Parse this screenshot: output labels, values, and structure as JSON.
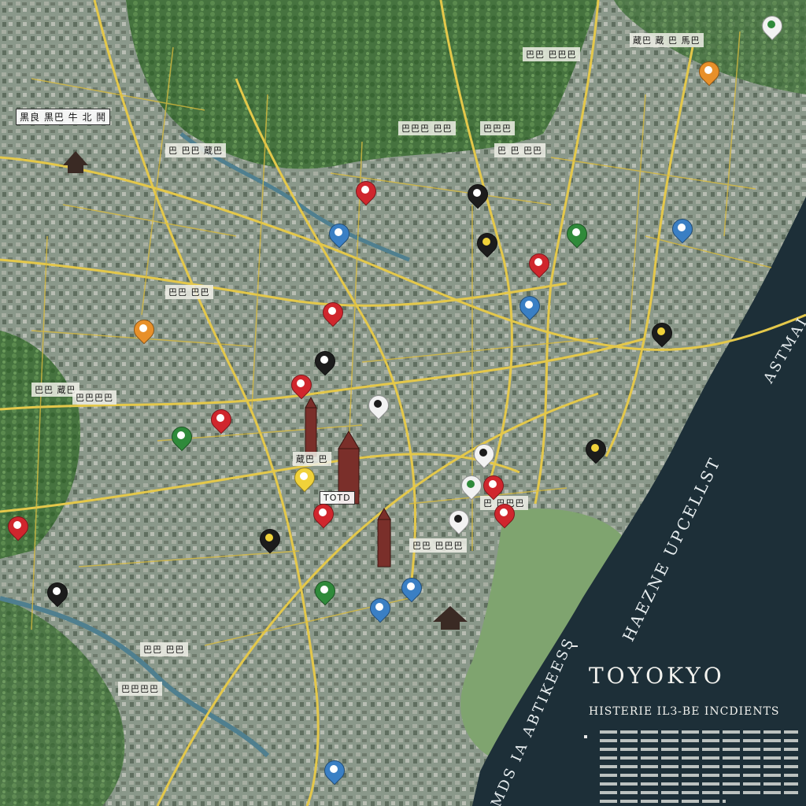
{
  "map": {
    "title": "TOYOKYO",
    "subtitle": "HISTERIE ILЗ-BE INCDIENTS",
    "sea_labels": {
      "upper": "ASTMAI",
      "middle_1": "HAEZNE UPCELLST",
      "middle_2": "MDS IA ABTIKEESS"
    },
    "place_labels": [
      "黒良 黒巴 牛 北 鬨",
      "蔵巴 蔵 巴 馬巴",
      "巴巴 巴巴巴",
      "巴巴巴 巴巴",
      "巴 巴巴 蔵巴",
      "巴巴巴",
      "巴 巴 巴巴",
      "巴巴 巴巴",
      "巴巴 蔵巴",
      "巴巴巴巴",
      "蔵巴 巴",
      "巴巴 巴巴",
      "TOTD",
      "巴巴 巴巴巴",
      "巴巴巴巴",
      "巴 巴巴巴"
    ],
    "colors": {
      "sea": "#1d2f38",
      "land": "#6b8a5e",
      "forest": "#3f6b3a",
      "roads": "#e4c84a",
      "urban": "#8f9a8c",
      "pin_red": "#d0262d",
      "pin_blue": "#3a7fc4",
      "pin_green": "#2f8a3a",
      "pin_black": "#1c1c1c",
      "pin_orange": "#e8902a",
      "pin_white": "#f2f2f2",
      "pin_yellow": "#f0d23a"
    },
    "icons": [
      "map-pin-icon",
      "building-icon",
      "pagoda-icon",
      "tower-icon"
    ]
  }
}
